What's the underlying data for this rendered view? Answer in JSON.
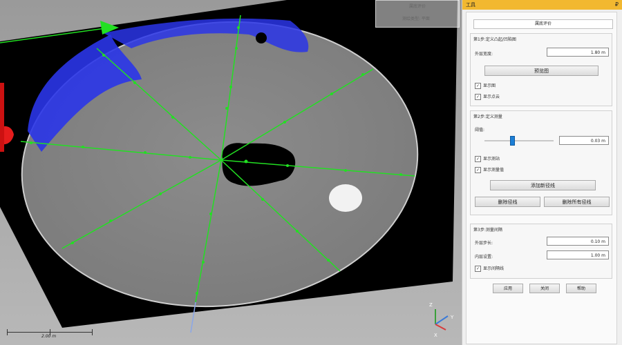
{
  "viewport": {
    "overlay_title": "属底评价",
    "overlay_subtitle": "测绘类型: 平面",
    "scale_label": "2.00 m",
    "axis": {
      "z": "Z",
      "x": "X",
      "y": "Y"
    }
  },
  "panel": {
    "title": "工具",
    "pin_glyph": "₽",
    "tab": "属底评价",
    "step1": {
      "title": "第1步:定义凸起/凹陷图",
      "outer_width_label": "外层宽度:",
      "outer_width_value": "1.80 m",
      "preview_button": "预览图",
      "show_map": "显示图",
      "show_points": "显示点云"
    },
    "step2": {
      "title": "第2步:定义测量",
      "threshold_label": "阈值:",
      "threshold_value": "0.03 m",
      "threshold_fraction": 0.4,
      "show_stations": "显示测站",
      "show_measure_values": "显示测量值",
      "add_path_button": "添加新径线",
      "delete_path_button": "删除径线",
      "delete_all_button": "删除所有径线"
    },
    "step3": {
      "title": "第3步:测量间隔",
      "outer_step_label": "外层步长:",
      "outer_step_value": "0.10 m",
      "inner_pos_label": "内层设置:",
      "inner_pos_value": "1.00 m",
      "show_interval": "显示间隔线"
    },
    "apply_button": "应用",
    "close_button": "关闭",
    "help_button": "帮助"
  },
  "colors": {
    "accent": "#f2b830",
    "measure_line": "#22e022",
    "low_region": "#2a35e8",
    "slider": "#1c7fd6"
  }
}
